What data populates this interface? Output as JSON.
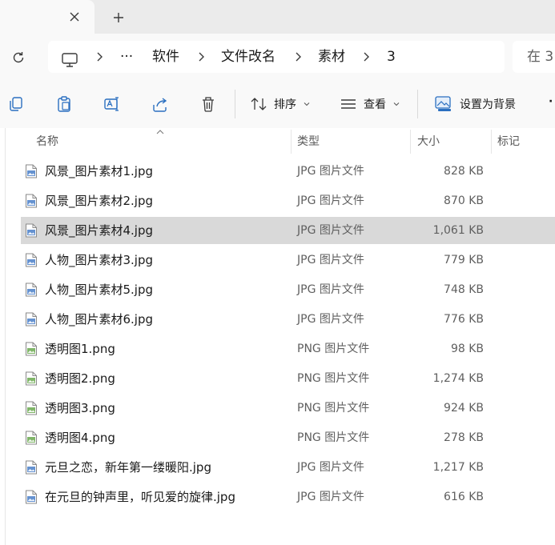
{
  "tabs": {
    "close_glyph": "✕",
    "add_glyph": "+"
  },
  "address": {
    "more": "···",
    "crumbs": [
      "软件",
      "文件改名",
      "素材",
      "3"
    ]
  },
  "search": {
    "placeholder": "在 3"
  },
  "commandbar": {
    "sort_label": "排序",
    "view_label": "查看",
    "wallpaper_label": "设置为背景",
    "more": "·"
  },
  "columns": {
    "name": "名称",
    "type": "类型",
    "size": "大小",
    "tags": "标记"
  },
  "files": [
    {
      "name": "风景_图片素材1.jpg",
      "type": "JPG 图片文件",
      "size": "828 KB",
      "kind": "jpg"
    },
    {
      "name": "风景_图片素材2.jpg",
      "type": "JPG 图片文件",
      "size": "870 KB",
      "kind": "jpg"
    },
    {
      "name": "风景_图片素材4.jpg",
      "type": "JPG 图片文件",
      "size": "1,061 KB",
      "kind": "jpg",
      "selected": true
    },
    {
      "name": "人物_图片素材3.jpg",
      "type": "JPG 图片文件",
      "size": "779 KB",
      "kind": "jpg"
    },
    {
      "name": "人物_图片素材5.jpg",
      "type": "JPG 图片文件",
      "size": "748 KB",
      "kind": "jpg"
    },
    {
      "name": "人物_图片素材6.jpg",
      "type": "JPG 图片文件",
      "size": "776 KB",
      "kind": "jpg"
    },
    {
      "name": "透明图1.png",
      "type": "PNG 图片文件",
      "size": "98 KB",
      "kind": "png"
    },
    {
      "name": "透明图2.png",
      "type": "PNG 图片文件",
      "size": "1,274 KB",
      "kind": "png"
    },
    {
      "name": "透明图3.png",
      "type": "PNG 图片文件",
      "size": "924 KB",
      "kind": "png"
    },
    {
      "name": "透明图4.png",
      "type": "PNG 图片文件",
      "size": "278 KB",
      "kind": "png"
    },
    {
      "name": "元旦之恋，新年第一缕暖阳.jpg",
      "type": "JPG 图片文件",
      "size": "1,217 KB",
      "kind": "jpg"
    },
    {
      "name": "在元旦的钟声里，听见爱的旋律.jpg",
      "type": "JPG 图片文件",
      "size": "616 KB",
      "kind": "jpg"
    }
  ],
  "colors": {
    "selected_row": "#d9d9d9",
    "jpg_icon": "#4a7fc8",
    "png_icon": "#6aa84f",
    "accent": "#1f6fc5"
  }
}
